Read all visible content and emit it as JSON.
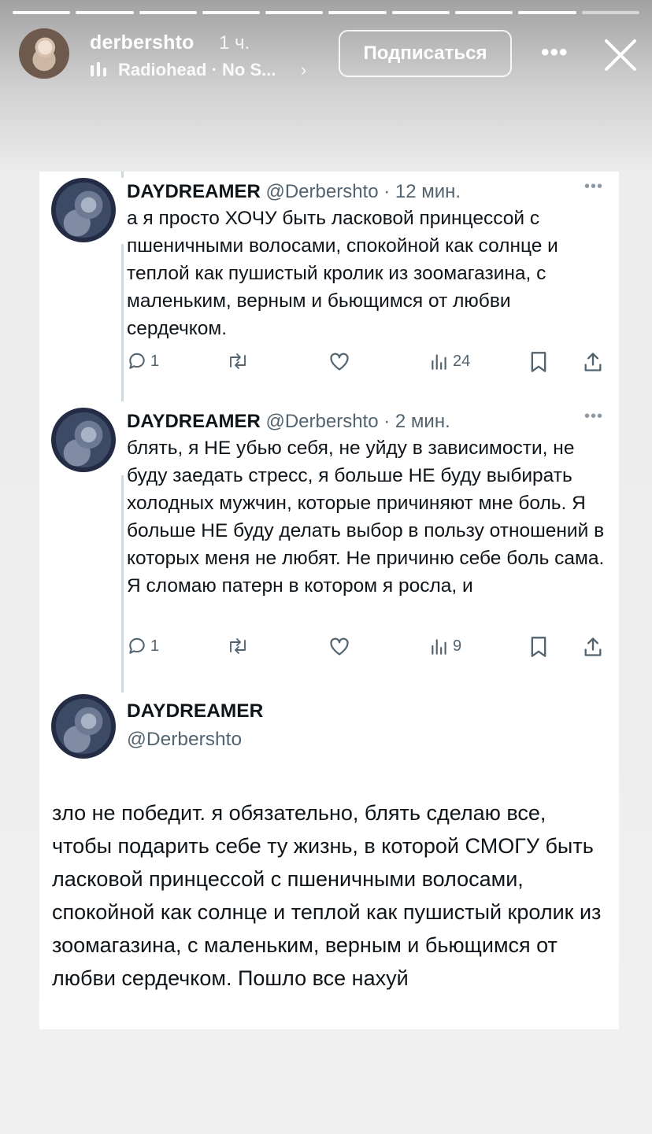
{
  "story": {
    "username": "derbershto",
    "time": "1 ч.",
    "music": "Radiohead · No S...",
    "follow_label": "Подписаться",
    "progress_segments": 10
  },
  "tweets": [
    {
      "display_name": "DAYDREAMER",
      "handle": "@Derbershto",
      "time": "· 12 мин.",
      "text": "а я просто ХОЧУ быть ласковой принцессой с пшеничными волосами, спокойной как солнце и теплой как пушистый кролик из зоомагазина, с маленьким, верным и бьющимся от любви сердечком.",
      "replies": "1",
      "views": "24"
    },
    {
      "display_name": "DAYDREAMER",
      "handle": "@Derbershto",
      "time": "· 2 мин.",
      "text": "блять, я НЕ убью себя, не уйду в зависимости, не буду заедать стресс, я больше НЕ буду выбирать холодных мужчин, которые причиняют мне боль. Я больше НЕ буду делать выбор в пользу отношений в которых меня не любят. Не причиню себе боль сама. Я сломаю патерн в котором я росла, и",
      "replies": "1",
      "views": "9"
    },
    {
      "display_name": "DAYDREAMER",
      "handle": "@Derbershto",
      "text": "зло не победит. я обязательно, блять сделаю все, чтобы подарить себе ту жизнь, в которой СМОГУ быть ласковой принцессой с пшеничными волосами, спокойной как солнце и теплой как пушистый кролик из зоомагазина, с маленьким, верным и бьющимся от любви сердечком. Пошло все нахуй"
    }
  ]
}
